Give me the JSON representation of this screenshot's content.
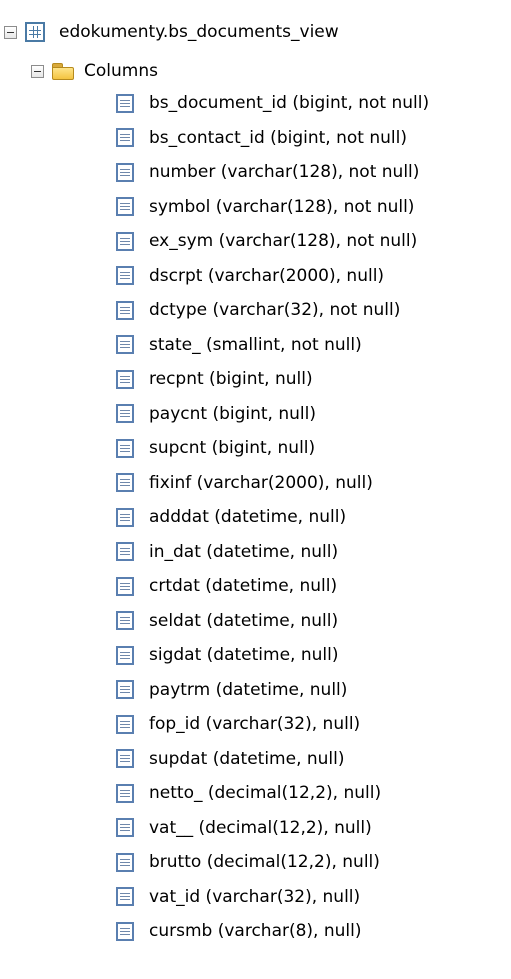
{
  "tree": {
    "root": {
      "label": "edokumenty.bs_documents_view",
      "icon": "view-icon",
      "expanded": true
    },
    "columns_folder": {
      "label": "Columns",
      "icon": "folder-icon",
      "expanded": true
    },
    "columns": [
      {
        "label": "bs_document_id (bigint, not null)"
      },
      {
        "label": "bs_contact_id (bigint, not null)"
      },
      {
        "label": "number (varchar(128), not null)"
      },
      {
        "label": "symbol (varchar(128), not null)"
      },
      {
        "label": "ex_sym (varchar(128), not null)"
      },
      {
        "label": "dscrpt (varchar(2000), null)"
      },
      {
        "label": "dctype (varchar(32), not null)"
      },
      {
        "label": "state_ (smallint, not null)"
      },
      {
        "label": "recpnt (bigint, null)"
      },
      {
        "label": "paycnt (bigint, null)"
      },
      {
        "label": "supcnt (bigint, null)"
      },
      {
        "label": "fixinf (varchar(2000), null)"
      },
      {
        "label": "adddat (datetime, null)"
      },
      {
        "label": "in_dat (datetime, null)"
      },
      {
        "label": "crtdat (datetime, null)"
      },
      {
        "label": "seldat (datetime, null)"
      },
      {
        "label": "sigdat (datetime, null)"
      },
      {
        "label": "paytrm (datetime, null)"
      },
      {
        "label": "fop_id (varchar(32), null)"
      },
      {
        "label": "supdat (datetime, null)"
      },
      {
        "label": "netto_ (decimal(12,2), null)"
      },
      {
        "label": "vat__ (decimal(12,2), null)"
      },
      {
        "label": "brutto (decimal(12,2), null)"
      },
      {
        "label": "vat_id (varchar(32), null)"
      },
      {
        "label": "cursmb (varchar(8), null)"
      }
    ],
    "column_icon": "column-icon",
    "colors": {
      "folder": "#f4c340",
      "icon_blue": "#4a7aa5",
      "text": "#000000",
      "background": "#ffffff"
    }
  }
}
